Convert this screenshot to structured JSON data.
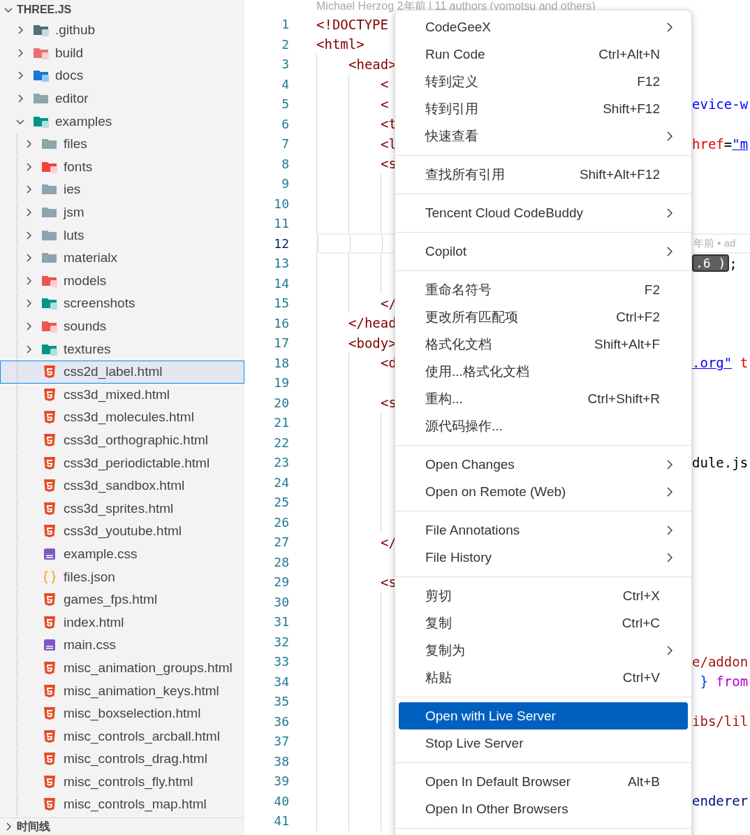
{
  "explorer": {
    "title": "THREE.JS",
    "expanded": true,
    "children": [
      {
        "label": ".github",
        "kind": "github",
        "expanded": false,
        "selected": false
      },
      {
        "label": "build",
        "kind": "build",
        "expanded": false,
        "selected": false
      },
      {
        "label": "docs",
        "kind": "docs",
        "expanded": false,
        "selected": false
      },
      {
        "label": "editor",
        "kind": "folder",
        "expanded": false,
        "selected": false
      },
      {
        "label": "examples",
        "kind": "examples",
        "expanded": true,
        "selected": false,
        "children": [
          {
            "label": "files",
            "kind": "folder",
            "expanded": false,
            "selected": false
          },
          {
            "label": "fonts",
            "kind": "fonts",
            "expanded": false,
            "selected": false
          },
          {
            "label": "ies",
            "kind": "folder",
            "expanded": false,
            "selected": false
          },
          {
            "label": "jsm",
            "kind": "folder",
            "expanded": false,
            "selected": false
          },
          {
            "label": "luts",
            "kind": "folder",
            "expanded": false,
            "selected": false
          },
          {
            "label": "materialx",
            "kind": "folder",
            "expanded": false,
            "selected": false
          },
          {
            "label": "models",
            "kind": "models",
            "expanded": false,
            "selected": false
          },
          {
            "label": "screenshots",
            "kind": "images",
            "expanded": false,
            "selected": false
          },
          {
            "label": "sounds",
            "kind": "sounds",
            "expanded": false,
            "selected": false
          },
          {
            "label": "textures",
            "kind": "images",
            "expanded": false,
            "selected": false
          },
          {
            "label": "css2d_label.html",
            "kind": "html",
            "selected": true
          },
          {
            "label": "css3d_mixed.html",
            "kind": "html",
            "selected": false
          },
          {
            "label": "css3d_molecules.html",
            "kind": "html",
            "selected": false
          },
          {
            "label": "css3d_orthographic.html",
            "kind": "html",
            "selected": false
          },
          {
            "label": "css3d_periodictable.html",
            "kind": "html",
            "selected": false
          },
          {
            "label": "css3d_sandbox.html",
            "kind": "html",
            "selected": false
          },
          {
            "label": "css3d_sprites.html",
            "kind": "html",
            "selected": false
          },
          {
            "label": "css3d_youtube.html",
            "kind": "html",
            "selected": false
          },
          {
            "label": "example.css",
            "kind": "css",
            "selected": false
          },
          {
            "label": "files.json",
            "kind": "json",
            "selected": false
          },
          {
            "label": "games_fps.html",
            "kind": "html",
            "selected": false
          },
          {
            "label": "index.html",
            "kind": "html",
            "selected": false
          },
          {
            "label": "main.css",
            "kind": "css",
            "selected": false
          },
          {
            "label": "misc_animation_groups.html",
            "kind": "html",
            "selected": false
          },
          {
            "label": "misc_animation_keys.html",
            "kind": "html",
            "selected": false
          },
          {
            "label": "misc_boxselection.html",
            "kind": "html",
            "selected": false
          },
          {
            "label": "misc_controls_arcball.html",
            "kind": "html",
            "selected": false
          },
          {
            "label": "misc_controls_drag.html",
            "kind": "html",
            "selected": false
          },
          {
            "label": "misc_controls_fly.html",
            "kind": "html",
            "selected": false
          },
          {
            "label": "misc_controls_map.html",
            "kind": "html",
            "selected": false
          }
        ]
      }
    ]
  },
  "timeline": {
    "title": "时间线",
    "expanded": false
  },
  "editor": {
    "blame": "Michael Herzog 2年前 | 11 authors (yomotsu and others)",
    "lines": [
      {
        "number": "1",
        "code": "<!DOCTYPE",
        "current": false
      },
      {
        "number": "2",
        "code": "<html>",
        "current": false
      },
      {
        "number": "3",
        "code": "<head>",
        "current": false
      },
      {
        "number": "4",
        "code": "<",
        "current": false
      },
      {
        "number": "5",
        "code": "<",
        "current": false,
        "right": [
          {
            "text": "evice-w",
            "kind": "str"
          }
        ]
      },
      {
        "number": "6",
        "code": "<t",
        "current": false
      },
      {
        "number": "7",
        "code": "<l",
        "current": false,
        "right": [
          {
            "text": "href",
            "kind": "attr"
          },
          {
            "text": "=",
            "kind": "plain"
          },
          {
            "text": "\"m",
            "kind": "link"
          }
        ]
      },
      {
        "number": "8",
        "code": "<s",
        "current": false
      },
      {
        "number": "9",
        "current": false
      },
      {
        "number": "10",
        "current": false
      },
      {
        "number": "11",
        "current": false
      },
      {
        "number": "12",
        "current": true,
        "right": [
          {
            "text": "年前 • ad",
            "kind": "annotation"
          }
        ]
      },
      {
        "number": "13",
        "current": false,
        "right": [
          {
            "text": ".6 )",
            "kind": "hint"
          },
          {
            "text": ";",
            "kind": "plain"
          }
        ]
      },
      {
        "number": "14",
        "current": false
      },
      {
        "number": "15",
        "code": "</",
        "current": false
      },
      {
        "number": "16",
        "code": "</head",
        "current": false
      },
      {
        "number": "17",
        "code": "<body>",
        "current": false
      },
      {
        "number": "18",
        "code": "<d",
        "current": false,
        "right": [
          {
            "text": ".org\"",
            "kind": "link"
          },
          {
            "text": " t",
            "kind": "attr"
          }
        ]
      },
      {
        "number": "19",
        "current": false
      },
      {
        "number": "20",
        "code": "<s",
        "current": false
      },
      {
        "number": "21",
        "current": false
      },
      {
        "number": "22",
        "current": false
      },
      {
        "number": "23",
        "current": false,
        "right": [
          {
            "text": "dule.js",
            "kind": "plain"
          }
        ]
      },
      {
        "number": "24",
        "current": false
      },
      {
        "number": "25",
        "current": false
      },
      {
        "number": "26",
        "current": false
      },
      {
        "number": "27",
        "code": "</",
        "current": false
      },
      {
        "number": "28",
        "current": false
      },
      {
        "number": "29",
        "code": "<s",
        "current": false
      },
      {
        "number": "30",
        "current": false
      },
      {
        "number": "31",
        "current": false
      },
      {
        "number": "32",
        "current": false
      },
      {
        "number": "33",
        "current": false,
        "right": [
          {
            "text": "e/addon",
            "kind": "path"
          }
        ]
      },
      {
        "number": "34",
        "current": false,
        "right": [
          {
            "text": " } ",
            "kind": "brace"
          },
          {
            "text": "from",
            "kind": "keyword"
          }
        ]
      },
      {
        "number": "35",
        "current": false
      },
      {
        "number": "36",
        "current": false,
        "right": [
          {
            "text": "ibs/lil",
            "kind": "path"
          }
        ]
      },
      {
        "number": "37",
        "current": false
      },
      {
        "number": "38",
        "current": false
      },
      {
        "number": "39",
        "current": false
      },
      {
        "number": "40",
        "current": false,
        "right": [
          {
            "text": "enderer",
            "kind": "type"
          }
        ]
      },
      {
        "number": "41",
        "current": false
      }
    ]
  },
  "context_menu": {
    "groups": [
      {
        "items": [
          {
            "label": "CodeGeeX",
            "submenu": true,
            "selected": false
          },
          {
            "label": "Run Code",
            "shortcut": "Ctrl+Alt+N",
            "submenu": false,
            "selected": false
          },
          {
            "label": "转到定义",
            "shortcut": "F12",
            "submenu": false,
            "selected": false
          },
          {
            "label": "转到引用",
            "shortcut": "Shift+F12",
            "submenu": false,
            "selected": false
          },
          {
            "label": "快速查看",
            "submenu": true,
            "selected": false
          }
        ]
      },
      {
        "items": [
          {
            "label": "查找所有引用",
            "shortcut": "Shift+Alt+F12",
            "submenu": false,
            "selected": false
          }
        ]
      },
      {
        "items": [
          {
            "label": "Tencent Cloud CodeBuddy",
            "submenu": true,
            "selected": false
          }
        ]
      },
      {
        "items": [
          {
            "label": "Copilot",
            "submenu": true,
            "selected": false
          }
        ]
      },
      {
        "items": [
          {
            "label": "重命名符号",
            "shortcut": "F2",
            "submenu": false,
            "selected": false
          },
          {
            "label": "更改所有匹配项",
            "shortcut": "Ctrl+F2",
            "submenu": false,
            "selected": false
          },
          {
            "label": "格式化文档",
            "shortcut": "Shift+Alt+F",
            "submenu": false,
            "selected": false
          },
          {
            "label": "使用...格式化文档",
            "submenu": false,
            "selected": false
          },
          {
            "label": "重构...",
            "shortcut": "Ctrl+Shift+R",
            "submenu": false,
            "selected": false
          },
          {
            "label": "源代码操作...",
            "submenu": false,
            "selected": false
          }
        ]
      },
      {
        "items": [
          {
            "label": "Open Changes",
            "submenu": true,
            "selected": false
          },
          {
            "label": "Open on Remote (Web)",
            "submenu": true,
            "selected": false
          }
        ]
      },
      {
        "items": [
          {
            "label": "File Annotations",
            "submenu": true,
            "selected": false
          },
          {
            "label": "File History",
            "submenu": true,
            "selected": false
          }
        ]
      },
      {
        "items": [
          {
            "label": "剪切",
            "shortcut": "Ctrl+X",
            "submenu": false,
            "selected": false
          },
          {
            "label": "复制",
            "shortcut": "Ctrl+C",
            "submenu": false,
            "selected": false
          },
          {
            "label": "复制为",
            "submenu": true,
            "selected": false
          },
          {
            "label": "粘贴",
            "shortcut": "Ctrl+V",
            "submenu": false,
            "selected": false
          }
        ]
      },
      {
        "items": [
          {
            "label": "Open with Live Server",
            "submenu": false,
            "selected": true
          },
          {
            "label": "Stop Live Server",
            "submenu": false,
            "selected": false
          }
        ]
      },
      {
        "items": [
          {
            "label": "Open In Default Browser",
            "shortcut": "Alt+B",
            "submenu": false,
            "selected": false
          },
          {
            "label": "Open In Other Browsers",
            "submenu": false,
            "selected": false
          }
        ]
      }
    ]
  }
}
